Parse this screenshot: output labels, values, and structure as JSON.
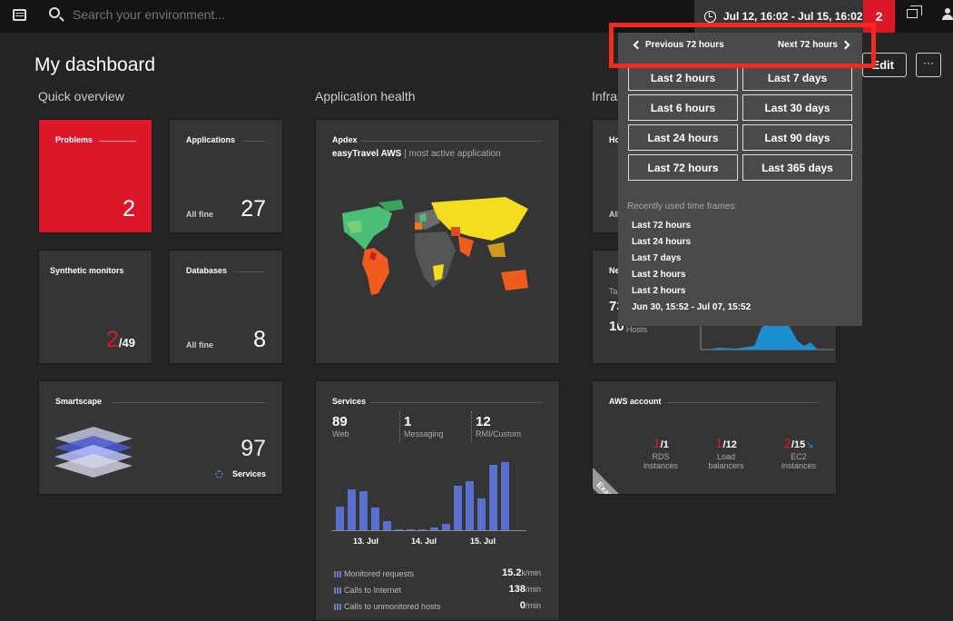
{
  "topbar": {
    "search_placeholder": "Search your environment...",
    "timeframe": "Jul 12, 16:02 - Jul 15, 16:02",
    "problem_count": "2"
  },
  "page": {
    "title": "My dashboard",
    "edit_label": "Edit",
    "more_label": "···"
  },
  "sections": {
    "quick": "Quick overview",
    "apphealth": "Application health",
    "infra": "Infrastructure"
  },
  "tiles": {
    "problems": {
      "title": "Problems",
      "value": "2"
    },
    "applications": {
      "title": "Applications",
      "status": "All fine",
      "value": "27"
    },
    "synthetic": {
      "title": "Synthetic monitors",
      "value": "2",
      "total": "/49"
    },
    "databases": {
      "title": "Databases",
      "status": "All fine",
      "value": "8"
    },
    "smartscape": {
      "title": "Smartscape",
      "value": "97",
      "label": "Services"
    },
    "apdex": {
      "title": "Apdex",
      "app": "easyTravel AWS",
      "sub": "| most active application"
    },
    "services": {
      "title": "Services",
      "web": {
        "value": "89",
        "label": "Web"
      },
      "messaging": {
        "value": "1",
        "label": "Messaging"
      },
      "rmi": {
        "value": "12",
        "label": "RMI/Custom"
      },
      "xlabels": [
        "13. Jul",
        "14. Jul",
        "15. Jul"
      ],
      "legend": [
        {
          "label": "Monitored requests",
          "value": "15.2",
          "unit": "k/min"
        },
        {
          "label": "Calls to Internet",
          "value": "138",
          "unit": "/min"
        },
        {
          "label": "Calls to unmonitored hosts",
          "value": "0",
          "unit": "/min"
        }
      ]
    },
    "hosts": {
      "title": "Ho",
      "status": "All"
    },
    "network": {
      "title": "Ne",
      "label1": "Tal",
      "value1": "73",
      "value2": "10",
      "label2": "Hosts"
    },
    "aws": {
      "title": "AWS account",
      "ribbon": "Example",
      "items": [
        {
          "red": "1",
          "total": "/1",
          "label1": "RDS",
          "label2": "instances"
        },
        {
          "red": "1",
          "total": "/12",
          "label1": "Load",
          "label2": "balancers"
        },
        {
          "red": "2",
          "total": "/15",
          "label1": "EC2",
          "label2": "instances"
        }
      ]
    }
  },
  "chart_data": {
    "type": "bar",
    "x": [
      "13. Jul",
      "14. Jul",
      "15. Jul"
    ],
    "values": [
      26,
      45,
      43,
      25,
      10,
      1,
      1,
      0,
      3,
      7,
      49,
      54,
      35,
      72,
      75
    ],
    "title": "",
    "xlabel": "",
    "ylabel": ""
  },
  "dropdown": {
    "previous": "Previous 72 hours",
    "next": "Next 72 hours",
    "options": [
      "Last 2 hours",
      "Last 7 days",
      "Last 6 hours",
      "Last 30 days",
      "Last 24 hours",
      "Last 90 days",
      "Last 72 hours",
      "Last 365 days"
    ],
    "recent_title": "Recently used time frames:",
    "recent": [
      "Last 72 hours",
      "Last 24 hours",
      "Last 7 days",
      "Last 2 hours",
      "Last 2 hours",
      "Jun 30, 15:52 - Jul 07, 15:52"
    ]
  },
  "colors": {
    "accent_red": "#dc172a",
    "bar_blue": "#5b6fce",
    "highlight": "#f32a1e"
  }
}
